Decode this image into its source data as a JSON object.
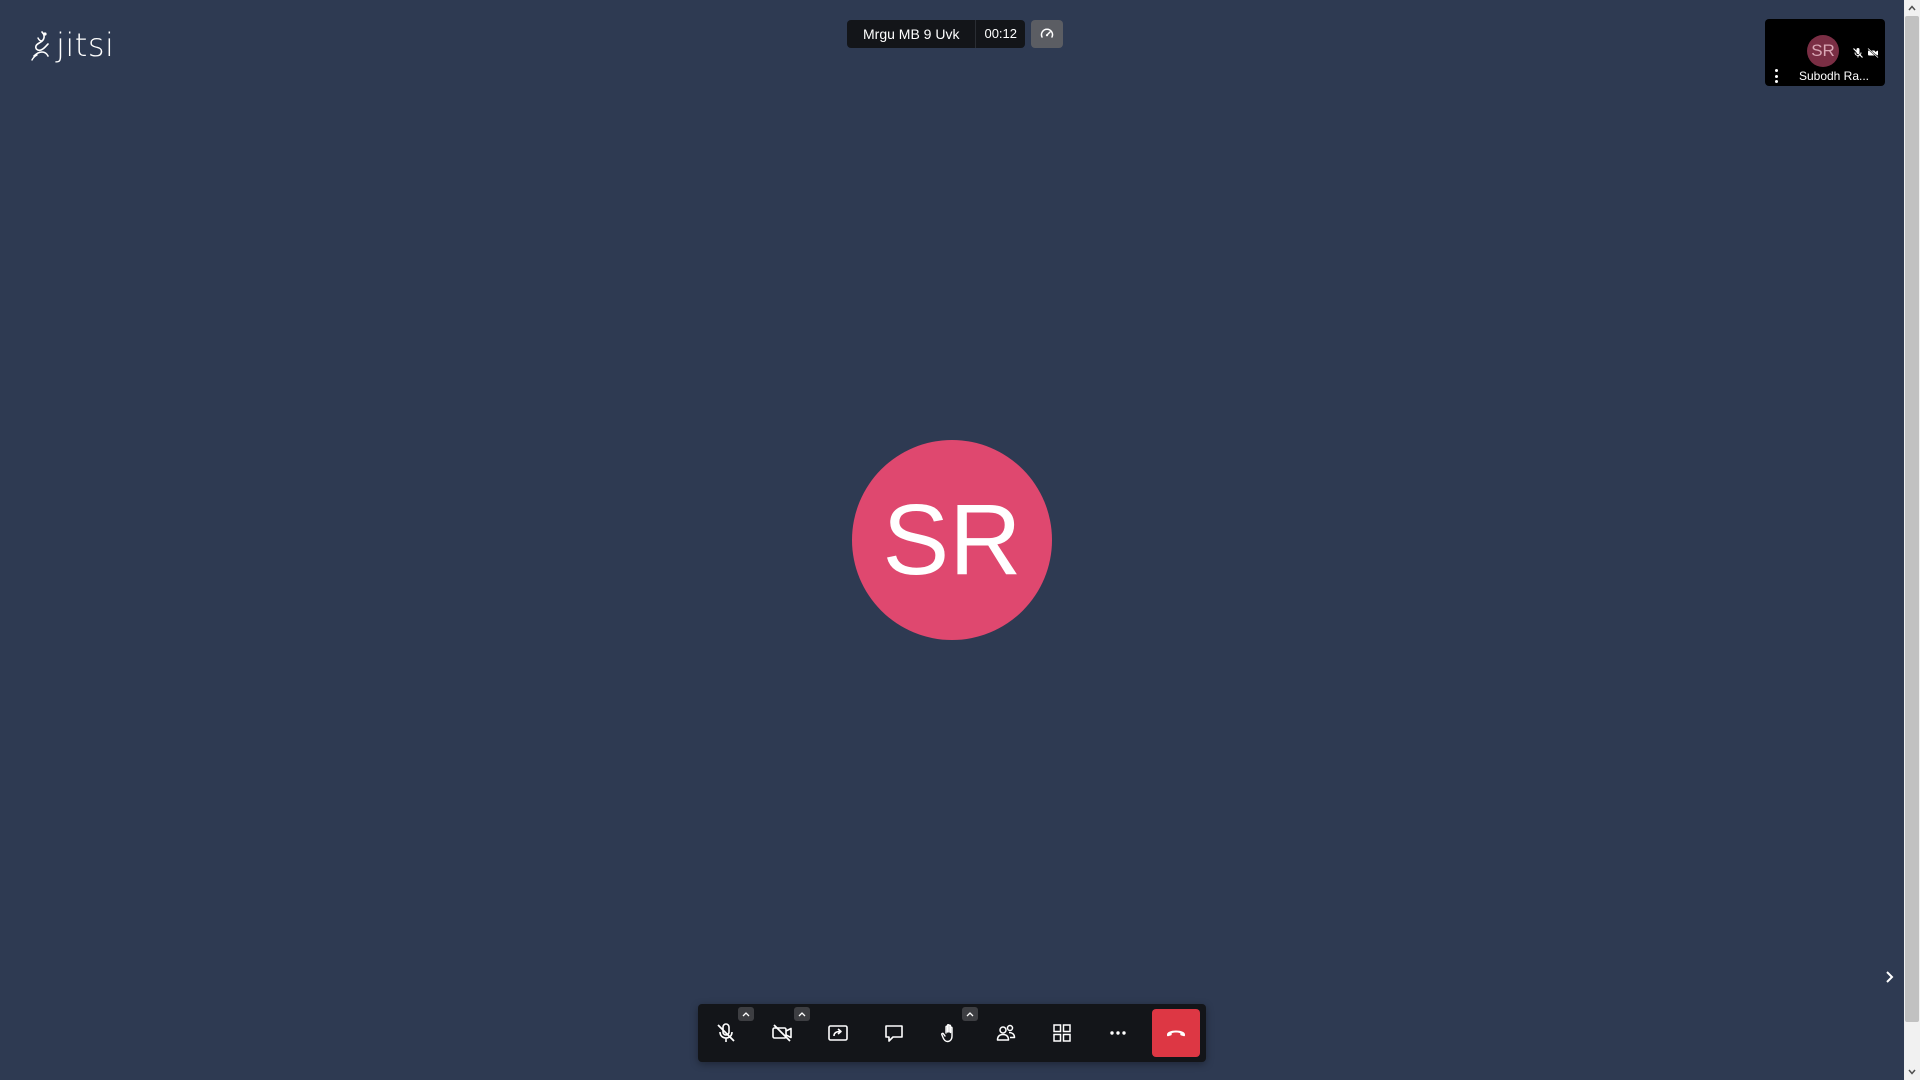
{
  "app": {
    "logo_text": "jitsi"
  },
  "header": {
    "meeting_subject": "Mrgu MB 9 Uvk",
    "timer": "00:12",
    "quality_icon": "gauge-icon"
  },
  "participant_tile": {
    "initials": "SR",
    "name": "Subodh Ra...",
    "avatar_color": "#7a2e44",
    "audio_muted": true,
    "video_muted": true
  },
  "main_stage": {
    "initials": "SR",
    "avatar_color": "#df486f"
  },
  "toolbar": {
    "buttons": [
      {
        "name": "microphone",
        "icon": "mic-off-icon",
        "has_menu": true
      },
      {
        "name": "camera",
        "icon": "camera-off-icon",
        "has_menu": true
      },
      {
        "name": "share-screen",
        "icon": "screen-share-icon",
        "has_menu": false
      },
      {
        "name": "chat",
        "icon": "chat-icon",
        "has_menu": false
      },
      {
        "name": "raise-hand",
        "icon": "hand-icon",
        "has_menu": true
      },
      {
        "name": "participants",
        "icon": "participants-icon",
        "has_menu": false
      },
      {
        "name": "tile-view",
        "icon": "grid-icon",
        "has_menu": false
      },
      {
        "name": "more-actions",
        "icon": "more-horizontal-icon",
        "has_menu": false
      },
      {
        "name": "leave-meeting",
        "icon": "hangup-icon",
        "has_menu": false
      }
    ],
    "hangup_color": "#dd3744"
  },
  "colors": {
    "background": "#2e3a52",
    "toolbar_bg": "#131519"
  }
}
